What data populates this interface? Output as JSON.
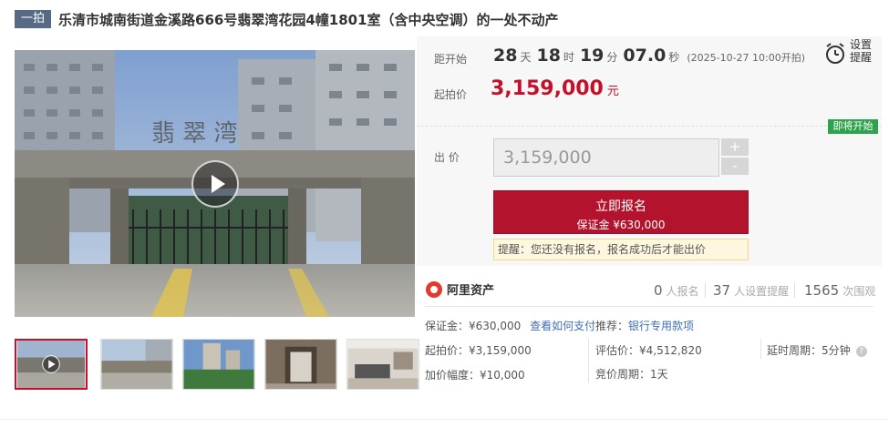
{
  "header": {
    "badge": "一拍",
    "title": "乐清市城南街道金溪路666号翡翠湾花园4幢1801室（含中央空调）的一处不动产"
  },
  "gallery": {
    "watermark_text": "翡 翠 湾",
    "thumbnail_count": 5
  },
  "auction": {
    "countdown_label": "距开始",
    "countdown": {
      "days": "28",
      "days_unit": "天",
      "hours": "18",
      "hours_unit": "时",
      "minutes": "19",
      "minutes_unit": "分",
      "seconds": "07.0",
      "seconds_unit": "秒"
    },
    "start_time_note": "(2025-10-27 10:00开拍)",
    "start_price_label": "起拍价",
    "start_price": "3,159,000",
    "start_price_unit": "元",
    "alarm_label": "设置提醒",
    "status_tag": "即将开始",
    "bid_label": "出 价",
    "bid_value": "3,159,000",
    "plus": "+",
    "minus": "-",
    "signup_label": "立即报名",
    "deposit_line": "保证金 ¥630,000",
    "tip": "提醒：您还没有报名，报名成功后才能出价"
  },
  "stats": {
    "platform": "阿里资产",
    "registered": "0",
    "registered_unit": "人报名",
    "reminders": "37",
    "reminders_unit": "人设置提醒",
    "views": "1565",
    "views_unit": "次围观"
  },
  "details": {
    "deposit": "保证金：¥630,000",
    "deposit_link": "查看如何支付",
    "recommend_label": "推荐：",
    "recommend_link": "银行专用款项",
    "start_price": "起拍价：¥3,159,000",
    "appraisal": "评估价：¥4,512,820",
    "delay": "延时周期：5分钟",
    "increment": "加价幅度：¥10,000",
    "bid_cycle": "竞价周期：1天"
  },
  "colors": {
    "accent": "#b3132d",
    "price": "#c5102a",
    "status_green": "#2ea34d",
    "link": "#3f6fb5",
    "badge": "#566a86"
  }
}
